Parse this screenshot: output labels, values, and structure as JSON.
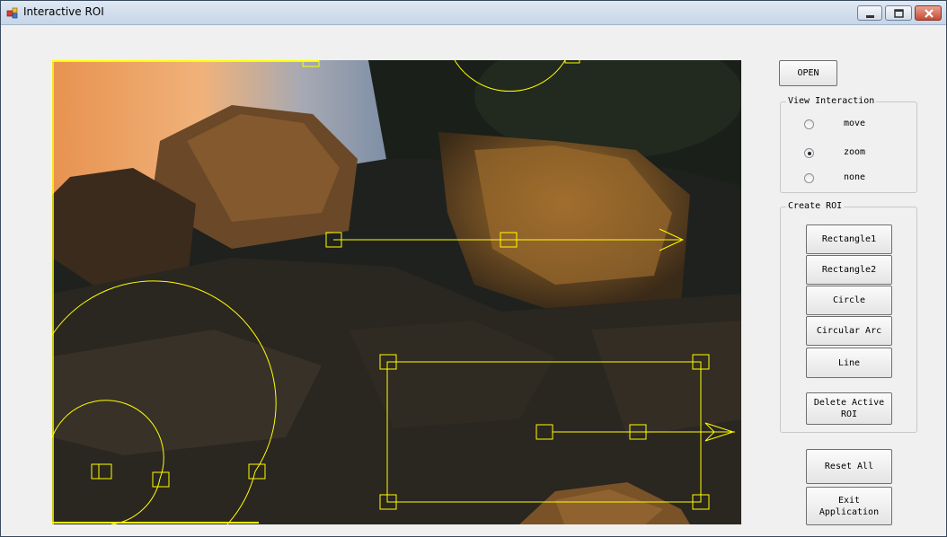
{
  "window": {
    "title": "Interactive ROI"
  },
  "toolbar": {
    "open_label": "OPEN"
  },
  "view_interaction": {
    "title": "View Interaction",
    "options": [
      {
        "label": "move",
        "checked": false
      },
      {
        "label": "zoom",
        "checked": true
      },
      {
        "label": "none",
        "checked": false
      }
    ]
  },
  "create_roi": {
    "title": "Create ROI",
    "rectangle1": "Rectangle1",
    "rectangle2": "Rectangle2",
    "circle": "Circle",
    "circular_arc": "Circular Arc",
    "line": "Line",
    "delete_active": "Delete Active\nROI"
  },
  "actions": {
    "reset_all": "Reset All",
    "exit": "Exit\nApplication"
  },
  "colors": {
    "roi": "#ffff00",
    "roi_active": "#ffff00"
  },
  "icons": [
    "app-icon",
    "minimize-icon",
    "maximize-icon",
    "close-icon"
  ]
}
